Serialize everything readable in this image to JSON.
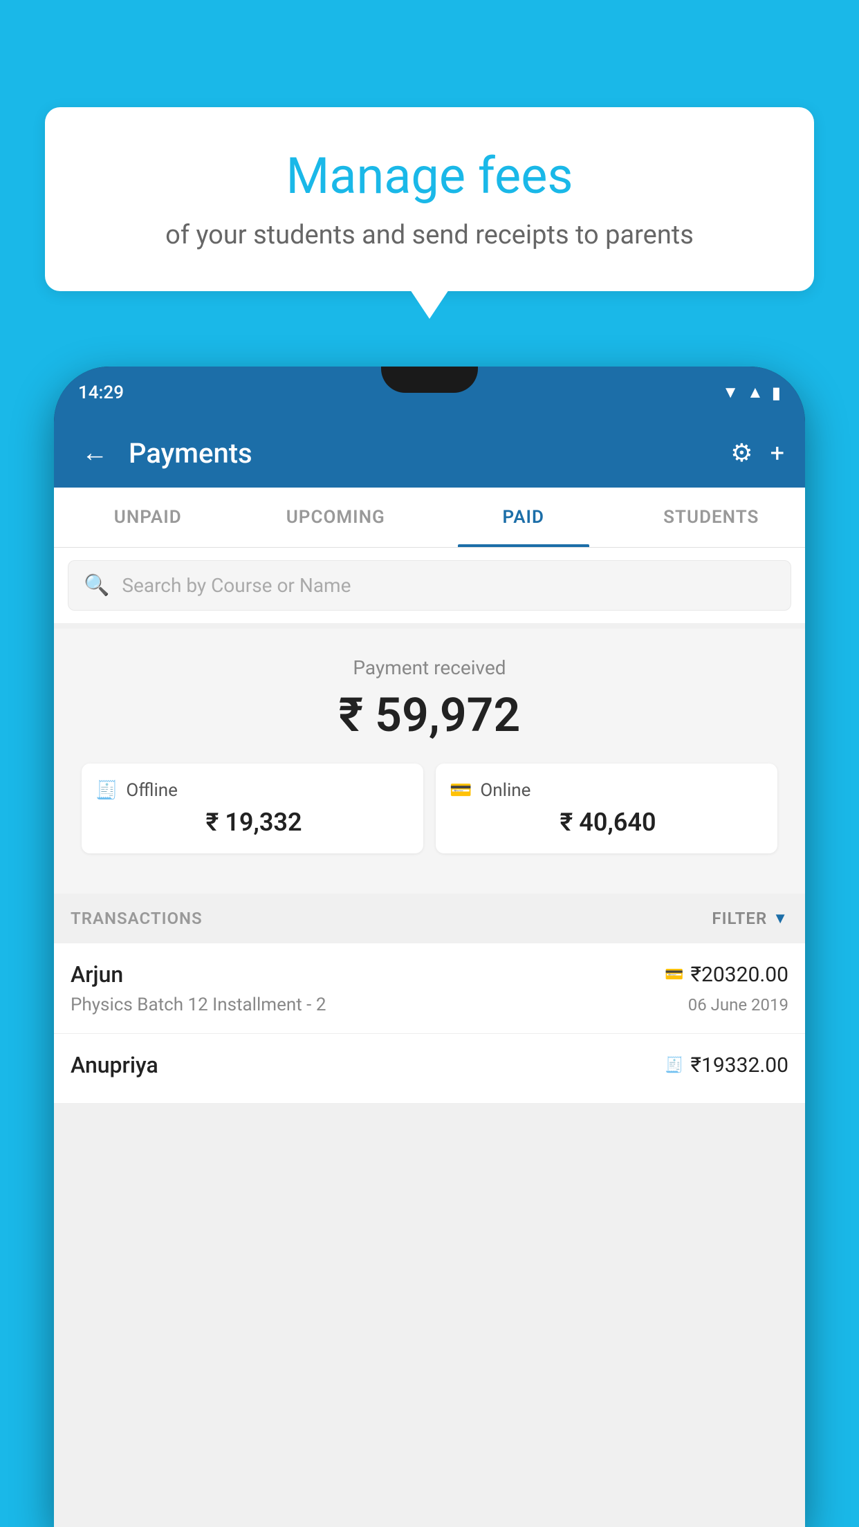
{
  "background": {
    "color": "#1ab8e8"
  },
  "bubble": {
    "title": "Manage fees",
    "subtitle": "of your students and send receipts to parents"
  },
  "phone": {
    "status_bar": {
      "time": "14:29"
    },
    "app_bar": {
      "title": "Payments",
      "back_label": "←",
      "gear_label": "⚙",
      "plus_label": "+"
    },
    "tabs": [
      {
        "label": "UNPAID",
        "active": false
      },
      {
        "label": "UPCOMING",
        "active": false
      },
      {
        "label": "PAID",
        "active": true
      },
      {
        "label": "STUDENTS",
        "active": false
      }
    ],
    "search": {
      "placeholder": "Search by Course or Name"
    },
    "payment_summary": {
      "label": "Payment received",
      "amount": "₹ 59,972",
      "offline_label": "Offline",
      "offline_amount": "₹ 19,332",
      "online_label": "Online",
      "online_amount": "₹ 40,640"
    },
    "transactions": {
      "section_label": "TRANSACTIONS",
      "filter_label": "FILTER",
      "items": [
        {
          "name": "Arjun",
          "course": "Physics Batch 12 Installment - 2",
          "amount": "₹20320.00",
          "date": "06 June 2019",
          "mode_icon": "💳"
        },
        {
          "name": "Anupriya",
          "course": "",
          "amount": "₹19332.00",
          "date": "",
          "mode_icon": "🧾"
        }
      ]
    }
  }
}
